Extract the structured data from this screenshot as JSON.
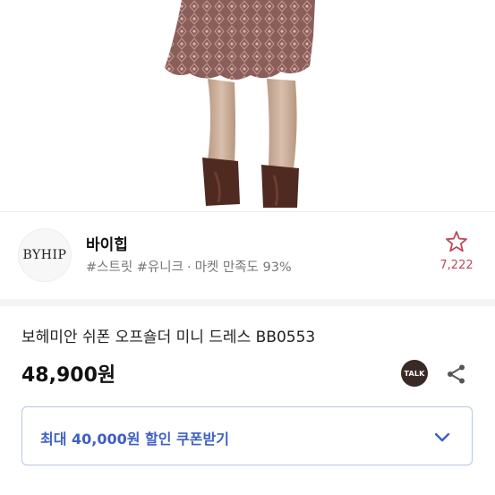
{
  "shop": {
    "logo_text": "BYHIP",
    "name": "바이힙",
    "tags": "#스트릿 #유니크",
    "separator": "·",
    "satisfaction": "마켓 만족도 93%",
    "likes": "7,222"
  },
  "product": {
    "title": "보헤미안 쉬폰 오프숄더 미니 드레스 BB0553",
    "price": "48,900원",
    "talk_label": "TALK"
  },
  "coupon": {
    "label": "최대 40,000원 할인 쿠폰받기"
  },
  "colors": {
    "coupon_text": "#3d5fc5",
    "coupon_border": "#b9c6e6",
    "likes": "#c0475a"
  },
  "icons": {
    "favorite": "star-outline-icon",
    "share": "share-icon",
    "chat": "kakao-talk-icon",
    "expand": "chevron-down-icon"
  }
}
